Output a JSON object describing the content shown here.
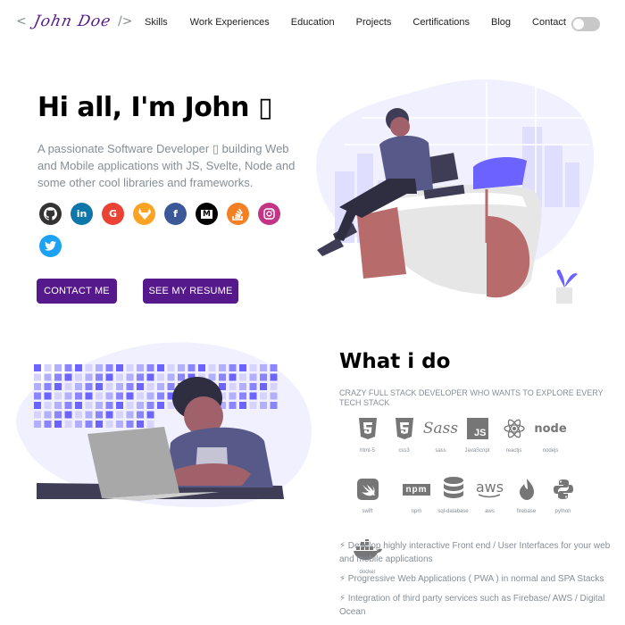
{
  "header": {
    "logo_open": "<",
    "logo_signature": "John Doe",
    "logo_close": "/>",
    "nav": [
      "Skills",
      "Work Experiences",
      "Education",
      "Projects",
      "Certifications",
      "Blog",
      "Contact"
    ]
  },
  "hero": {
    "title": "Hi all, I'm John ▯",
    "description": "A passionate Software Developer ▯ building Web and Mobile applications with JS, Svelte, Node and some other cool libraries and frameworks.",
    "socials": [
      {
        "icon": "github-icon",
        "glyph": "●",
        "color": "#333333"
      },
      {
        "icon": "linkedin-icon",
        "glyph": "in",
        "color": "#0e76a8"
      },
      {
        "icon": "google-icon",
        "glyph": "G",
        "color": "#ea4335"
      },
      {
        "icon": "gitlab-icon",
        "glyph": "▲",
        "color": "#fca326"
      },
      {
        "icon": "facebook-icon",
        "glyph": "f",
        "color": "#3b5998"
      },
      {
        "icon": "medium-icon",
        "glyph": "M",
        "color": "#000000"
      },
      {
        "icon": "stackoverflow-icon",
        "glyph": "≡",
        "color": "#f48024"
      },
      {
        "icon": "instagram-icon",
        "glyph": "◎",
        "color": "#c13584"
      },
      {
        "icon": "twitter-icon",
        "glyph": "✦",
        "color": "#1da1f2"
      }
    ],
    "contact_button": "CONTACT ME",
    "resume_button": "SEE MY RESUME"
  },
  "skills": {
    "title": "What i do",
    "subtitle": "CRAZY FULL STACK DEVELOPER WHO WANTS TO EXPLORE EVERY TECH STACK",
    "items": [
      {
        "label": "html-5",
        "icon": "html5-icon"
      },
      {
        "label": "css3",
        "icon": "css3-icon"
      },
      {
        "label": "sass",
        "icon": "sass-icon"
      },
      {
        "label": "JavaScript",
        "icon": "javascript-icon"
      },
      {
        "label": "reactjs",
        "icon": "react-icon"
      },
      {
        "label": "nodejs",
        "icon": "nodejs-icon"
      },
      {
        "label": "swift",
        "icon": "swift-icon"
      },
      {
        "label": "npm",
        "icon": "npm-icon"
      },
      {
        "label": "sql-database",
        "icon": "database-icon"
      },
      {
        "label": "aws",
        "icon": "aws-icon"
      },
      {
        "label": "firebase",
        "icon": "firebase-icon"
      },
      {
        "label": "python",
        "icon": "python-icon"
      },
      {
        "label": "docker",
        "icon": "docker-icon"
      }
    ],
    "bullets": [
      "⚡ Develop highly interactive Front end / User Interfaces for your web and mobile applications",
      "⚡ Progressive Web Applications ( PWA ) in normal and SPA Stacks",
      "⚡ Integration of third party services such as Firebase/ AWS / Digital Ocean"
    ]
  },
  "colors": {
    "accent": "#55198b",
    "muted": "#868e96",
    "illustration": "#6c63ff"
  }
}
